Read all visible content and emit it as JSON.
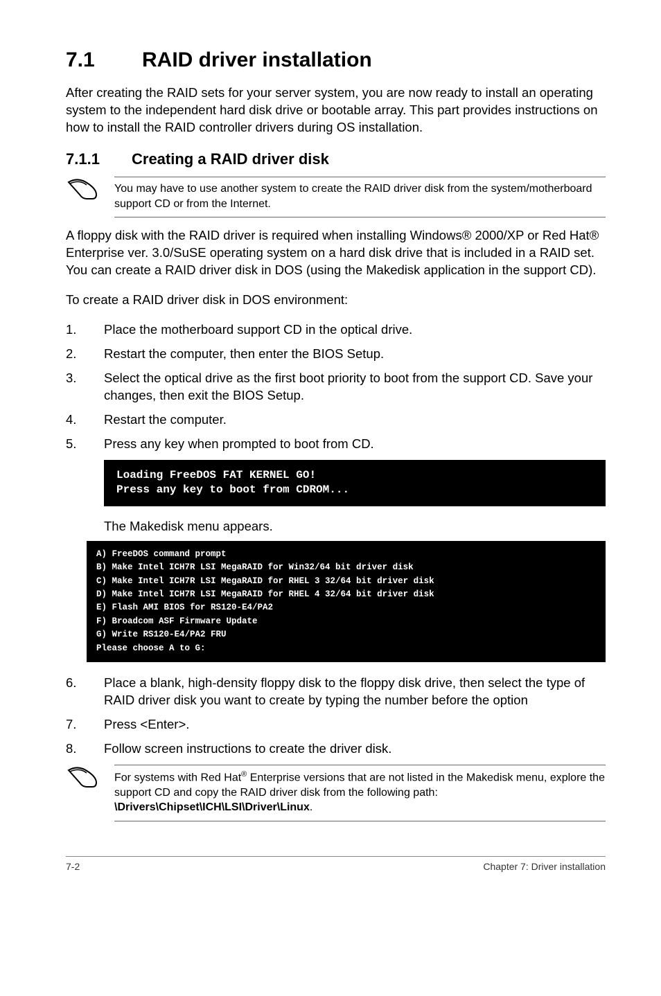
{
  "section": {
    "number": "7.1",
    "title": "RAID driver installation",
    "intro": "After creating the RAID sets for your server system, you are now ready to install an operating system to the independent hard disk drive or bootable array. This part provides instructions on how to install the RAID controller drivers during OS installation."
  },
  "subsection": {
    "number": "7.1.1",
    "title": "Creating a RAID driver disk"
  },
  "note1": "You may have to use another system to create the RAID driver disk from the system/motherboard support CD or from the Internet.",
  "para1": "A floppy disk with the RAID driver is required when installing Windows® 2000/XP or Red Hat® Enterprise ver. 3.0/SuSE operating system on a hard disk drive that is included in a RAID set. You can create a RAID driver disk in DOS (using the Makedisk application in the support CD).",
  "para2": "To create a RAID driver disk in DOS environment:",
  "steps_a": [
    "Place the motherboard support CD in the optical drive.",
    "Restart the computer, then enter the BIOS Setup.",
    "Select the optical drive as the first boot priority to boot from the support CD. Save your changes, then exit the BIOS Setup.",
    "Restart the computer.",
    "Press any key when prompted to boot from CD."
  ],
  "terminal1": "Loading FreeDOS FAT KERNEL GO!\nPress any key to boot from CDROM...",
  "after_term1": "The Makedisk menu appears.",
  "terminal2": "A) FreeDOS command prompt\nB) Make Intel ICH7R LSI MegaRAID for Win32/64 bit driver disk\nC) Make Intel ICH7R LSI MegaRAID for RHEL 3 32/64 bit driver disk\nD) Make Intel ICH7R LSI MegaRAID for RHEL 4 32/64 bit driver disk\nE) Flash AMI BIOS for RS120-E4/PA2\nF) Broadcom ASF Firmware Update\nG) Write RS120-E4/PA2 FRU\nPlease choose A to G:",
  "steps_b": [
    "Place a blank, high-density floppy disk to the floppy disk drive, then select the type of RAID driver disk you want to create by typing the number before the option",
    "Press <Enter>.",
    "Follow screen instructions to create the driver disk."
  ],
  "note2_pre": "For systems with Red Hat",
  "note2_sup": "®",
  "note2_mid": " Enterprise versions that are not listed in the Makedisk menu, explore the support CD and copy the RAID driver disk from the following path: ",
  "note2_path": "\\Drivers\\Chipset\\ICH\\LSI\\Driver\\Linux",
  "note2_end": ".",
  "footer": {
    "left": "7-2",
    "right": "Chapter 7: Driver installation"
  }
}
